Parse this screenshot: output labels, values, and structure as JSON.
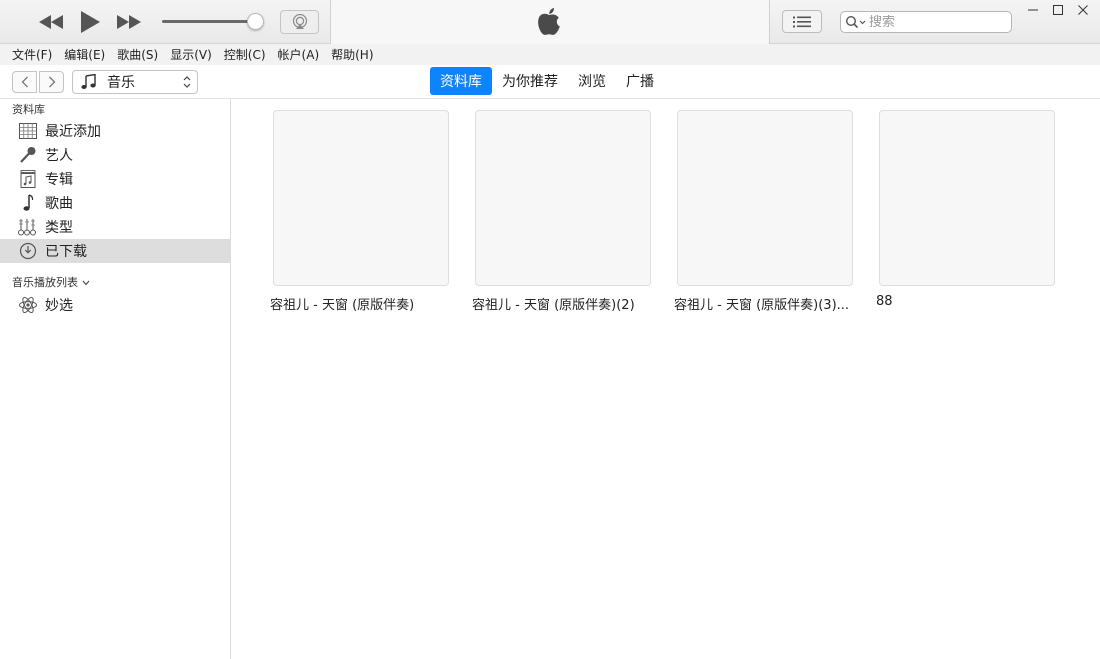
{
  "window": {
    "search_placeholder": "搜索"
  },
  "menu": [
    "文件(F)",
    "编辑(E)",
    "歌曲(S)",
    "显示(V)",
    "控制(C)",
    "帐户(A)",
    "帮助(H)"
  ],
  "nav": {
    "media_label": "音乐",
    "tabs": [
      "资料库",
      "为你推荐",
      "浏览",
      "广播"
    ],
    "active_tab": "资料库"
  },
  "sidebar": {
    "library_header": "资料库",
    "library_items": [
      {
        "label": "最近添加",
        "icon": "grid-icon"
      },
      {
        "label": "艺人",
        "icon": "microphone-icon"
      },
      {
        "label": "专辑",
        "icon": "album-icon"
      },
      {
        "label": "歌曲",
        "icon": "music-note-icon"
      },
      {
        "label": "类型",
        "icon": "genre-icon"
      },
      {
        "label": "已下载",
        "icon": "download-icon",
        "selected": true
      }
    ],
    "playlists_header": "音乐播放列表",
    "playlist_items": [
      {
        "label": "妙选",
        "icon": "atom-icon"
      }
    ]
  },
  "albums": [
    {
      "title": "容祖儿 - 天窗 (原版伴奏)"
    },
    {
      "title": "容祖儿 - 天窗 (原版伴奏)(2)"
    },
    {
      "title": "容祖儿 - 天窗 (原版伴奏)(3)..."
    },
    {
      "title": "88"
    }
  ],
  "colors": {
    "accent": "#0d84ff",
    "selected_row": "#dddddd",
    "artwork_bg": "#f7f7f7"
  }
}
